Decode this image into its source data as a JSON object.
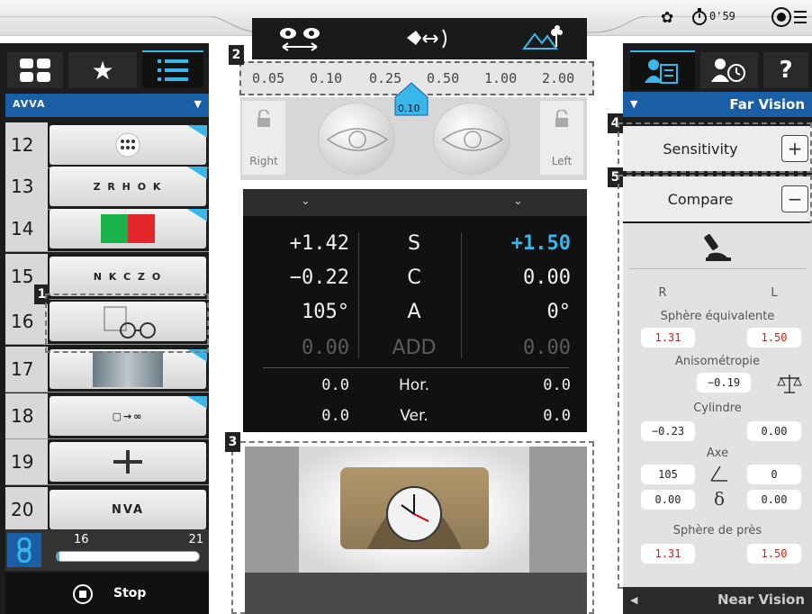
{
  "top_bar": {
    "icons": [
      "gear-icon",
      "stopwatch-icon",
      "menu-target-icon"
    ],
    "timer": "0'59"
  },
  "left_panel": {
    "tabs": [
      "grid-icon",
      "star-icon",
      "list-icon"
    ],
    "selected_tab": "list-icon",
    "header_label": "AVVA",
    "tests": [
      {
        "num": "12",
        "icon": "dot-grid-icon"
      },
      {
        "num": "13",
        "icon": "letter-chart-zrhok-icon",
        "text": "Z R H O K"
      },
      {
        "num": "14",
        "icon": "red-green-chart-icon"
      },
      {
        "num": "15",
        "icon": "letter-chart-nkczo-icon",
        "text": "N K C Z O"
      },
      {
        "num": "16",
        "icon": "prescription-glasses-icon"
      },
      {
        "num": "17",
        "icon": "eye-photo-icon"
      },
      {
        "num": "18",
        "icon": "far-infinity-icon",
        "text": "▢→∞"
      },
      {
        "num": "19",
        "icon": "cross-grid-icon"
      },
      {
        "num": "20",
        "icon": "nva-icon",
        "text": "NVA"
      }
    ],
    "progress": {
      "start": "16",
      "end": "21",
      "value_fraction": 0.02
    },
    "stop_label": "Stop"
  },
  "center": {
    "icons": [
      "binocular-eyes-icon",
      "distance-icon",
      "mountain-flower-icon"
    ],
    "acuity_scale": [
      "0.05",
      "0.10",
      "0.25",
      "0.50",
      "1.00",
      "2.00"
    ],
    "acuity_badge": "0.10",
    "eye_right_label": "Right",
    "eye_left_label": "Left",
    "rows": [
      {
        "left": "+1.42",
        "mid": "S",
        "right": "+1.50"
      },
      {
        "left": "−0.22",
        "mid": "C",
        "right": "0.00"
      },
      {
        "left": "105°",
        "mid": "A",
        "right": "0°"
      },
      {
        "left": "0.00",
        "mid": "ADD",
        "right": "0.00"
      },
      {
        "left": "0.0",
        "mid": "Hor.",
        "right": "0.0"
      },
      {
        "left": "0.0",
        "mid": "Ver.",
        "right": "0.0"
      }
    ],
    "accent_color": "#3ab7ea"
  },
  "right_panel": {
    "tabs": [
      "patient-record-icon",
      "patient-history-icon",
      "help-icon"
    ],
    "help_label": "?",
    "header": "Far Vision",
    "sensitivity_label": "Sensitivity",
    "compare_label": "Compare",
    "r_label": "R",
    "l_label": "L",
    "sphere_eq_label": "Sphère équivalente",
    "sphere_eq_r": "1.31",
    "sphere_eq_l": "1.50",
    "aniso_label": "Anisométropie",
    "aniso_value": "−0.19",
    "cyl_label": "Cylindre",
    "cyl_r": "−0.23",
    "cyl_l": "0.00",
    "axe_label": "Axe",
    "axe_r": "105",
    "axe_l": "0",
    "delta_r": "0.00",
    "delta_l": "0.00",
    "near_sphere_label": "Sphère de près",
    "near_sphere_r": "1.31",
    "near_sphere_l": "1.50",
    "near_vision_label": "Near Vision"
  },
  "callouts": [
    "1",
    "2",
    "3",
    "4",
    "5"
  ]
}
